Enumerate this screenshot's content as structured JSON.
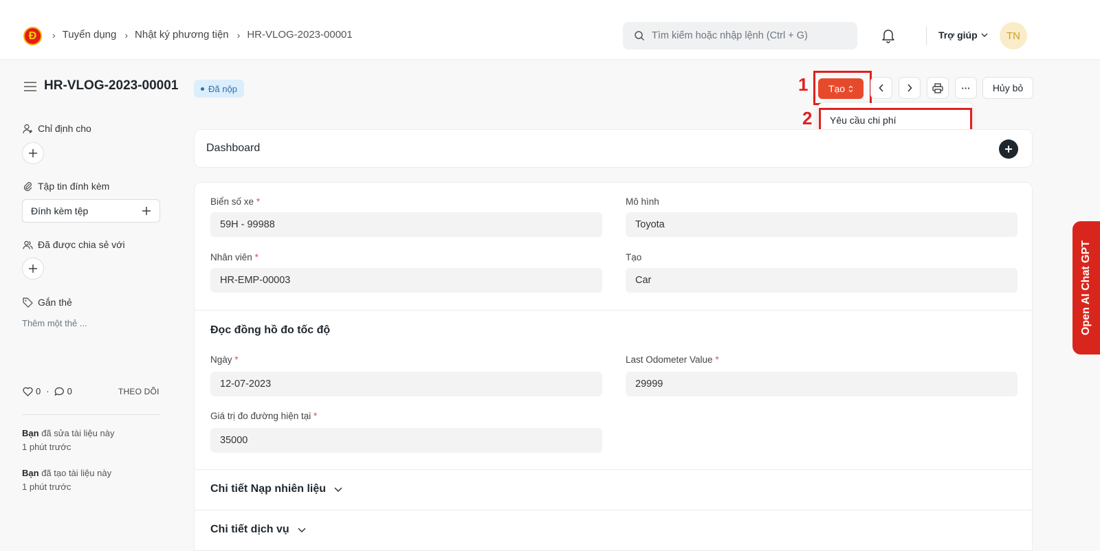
{
  "navbar": {
    "logo_text": "Đ",
    "breadcrumbs": [
      "Tuyển dụng",
      "Nhật ký phương tiện",
      "HR-VLOG-2023-00001"
    ],
    "search_placeholder": "Tìm kiếm hoặc nhập lệnh (Ctrl + G)",
    "help_label": "Trợ giúp",
    "avatar_initials": "TN"
  },
  "page": {
    "title": "HR-VLOG-2023-00001",
    "status": "Đã nộp",
    "create_label": "Tạo",
    "cancel_label": "Hủy bỏ",
    "more_label": "···"
  },
  "annotations": {
    "step1": "1",
    "step2": "2"
  },
  "dropdown": {
    "items": [
      "Yêu cầu chi phí"
    ]
  },
  "sidebar": {
    "assign_label": "Chỉ định cho",
    "attachments_label": "Tập tin đính kèm",
    "attach_button": "Đính kèm tệp",
    "shared_label": "Đã được chia sẻ với",
    "tags_label": "Gắn thẻ",
    "add_tag": "Thêm một thẻ ...",
    "likes": "0",
    "comments": "0",
    "follow_label": "THEO DÕI",
    "activity": [
      {
        "who": "Bạn",
        "what": "đã sửa tài liệu này",
        "when": "1 phút trước"
      },
      {
        "who": "Bạn",
        "what": "đã tạo tài liệu này",
        "when": "1 phút trước"
      }
    ]
  },
  "dashboard": {
    "title": "Dashboard"
  },
  "form": {
    "license_plate": {
      "label": "Biển số xe",
      "value": "59H - 99988"
    },
    "model": {
      "label": "Mô hình",
      "value": "Toyota"
    },
    "employee": {
      "label": "Nhân viên",
      "value": "HR-EMP-00003"
    },
    "make": {
      "label": "Tạo",
      "value": "Car"
    },
    "odometer_section": "Đọc đồng hồ đo tốc độ",
    "date": {
      "label": "Ngày",
      "value": "12-07-2023"
    },
    "last_odometer": {
      "label": "Last Odometer Value",
      "value": "29999"
    },
    "current_odometer": {
      "label": "Giá trị đo đường hiện tại",
      "value": "35000"
    },
    "fuel_section": "Chi tiết Nạp nhiên liệu",
    "service_section": "Chi tiết dịch vụ"
  },
  "side_tab": {
    "label": "Open AI Chat GPT"
  },
  "colors": {
    "primary": "#e74a2b",
    "annotation": "#e02020",
    "badge_bg": "#dbeefc",
    "side_tab": "#d9261c"
  }
}
